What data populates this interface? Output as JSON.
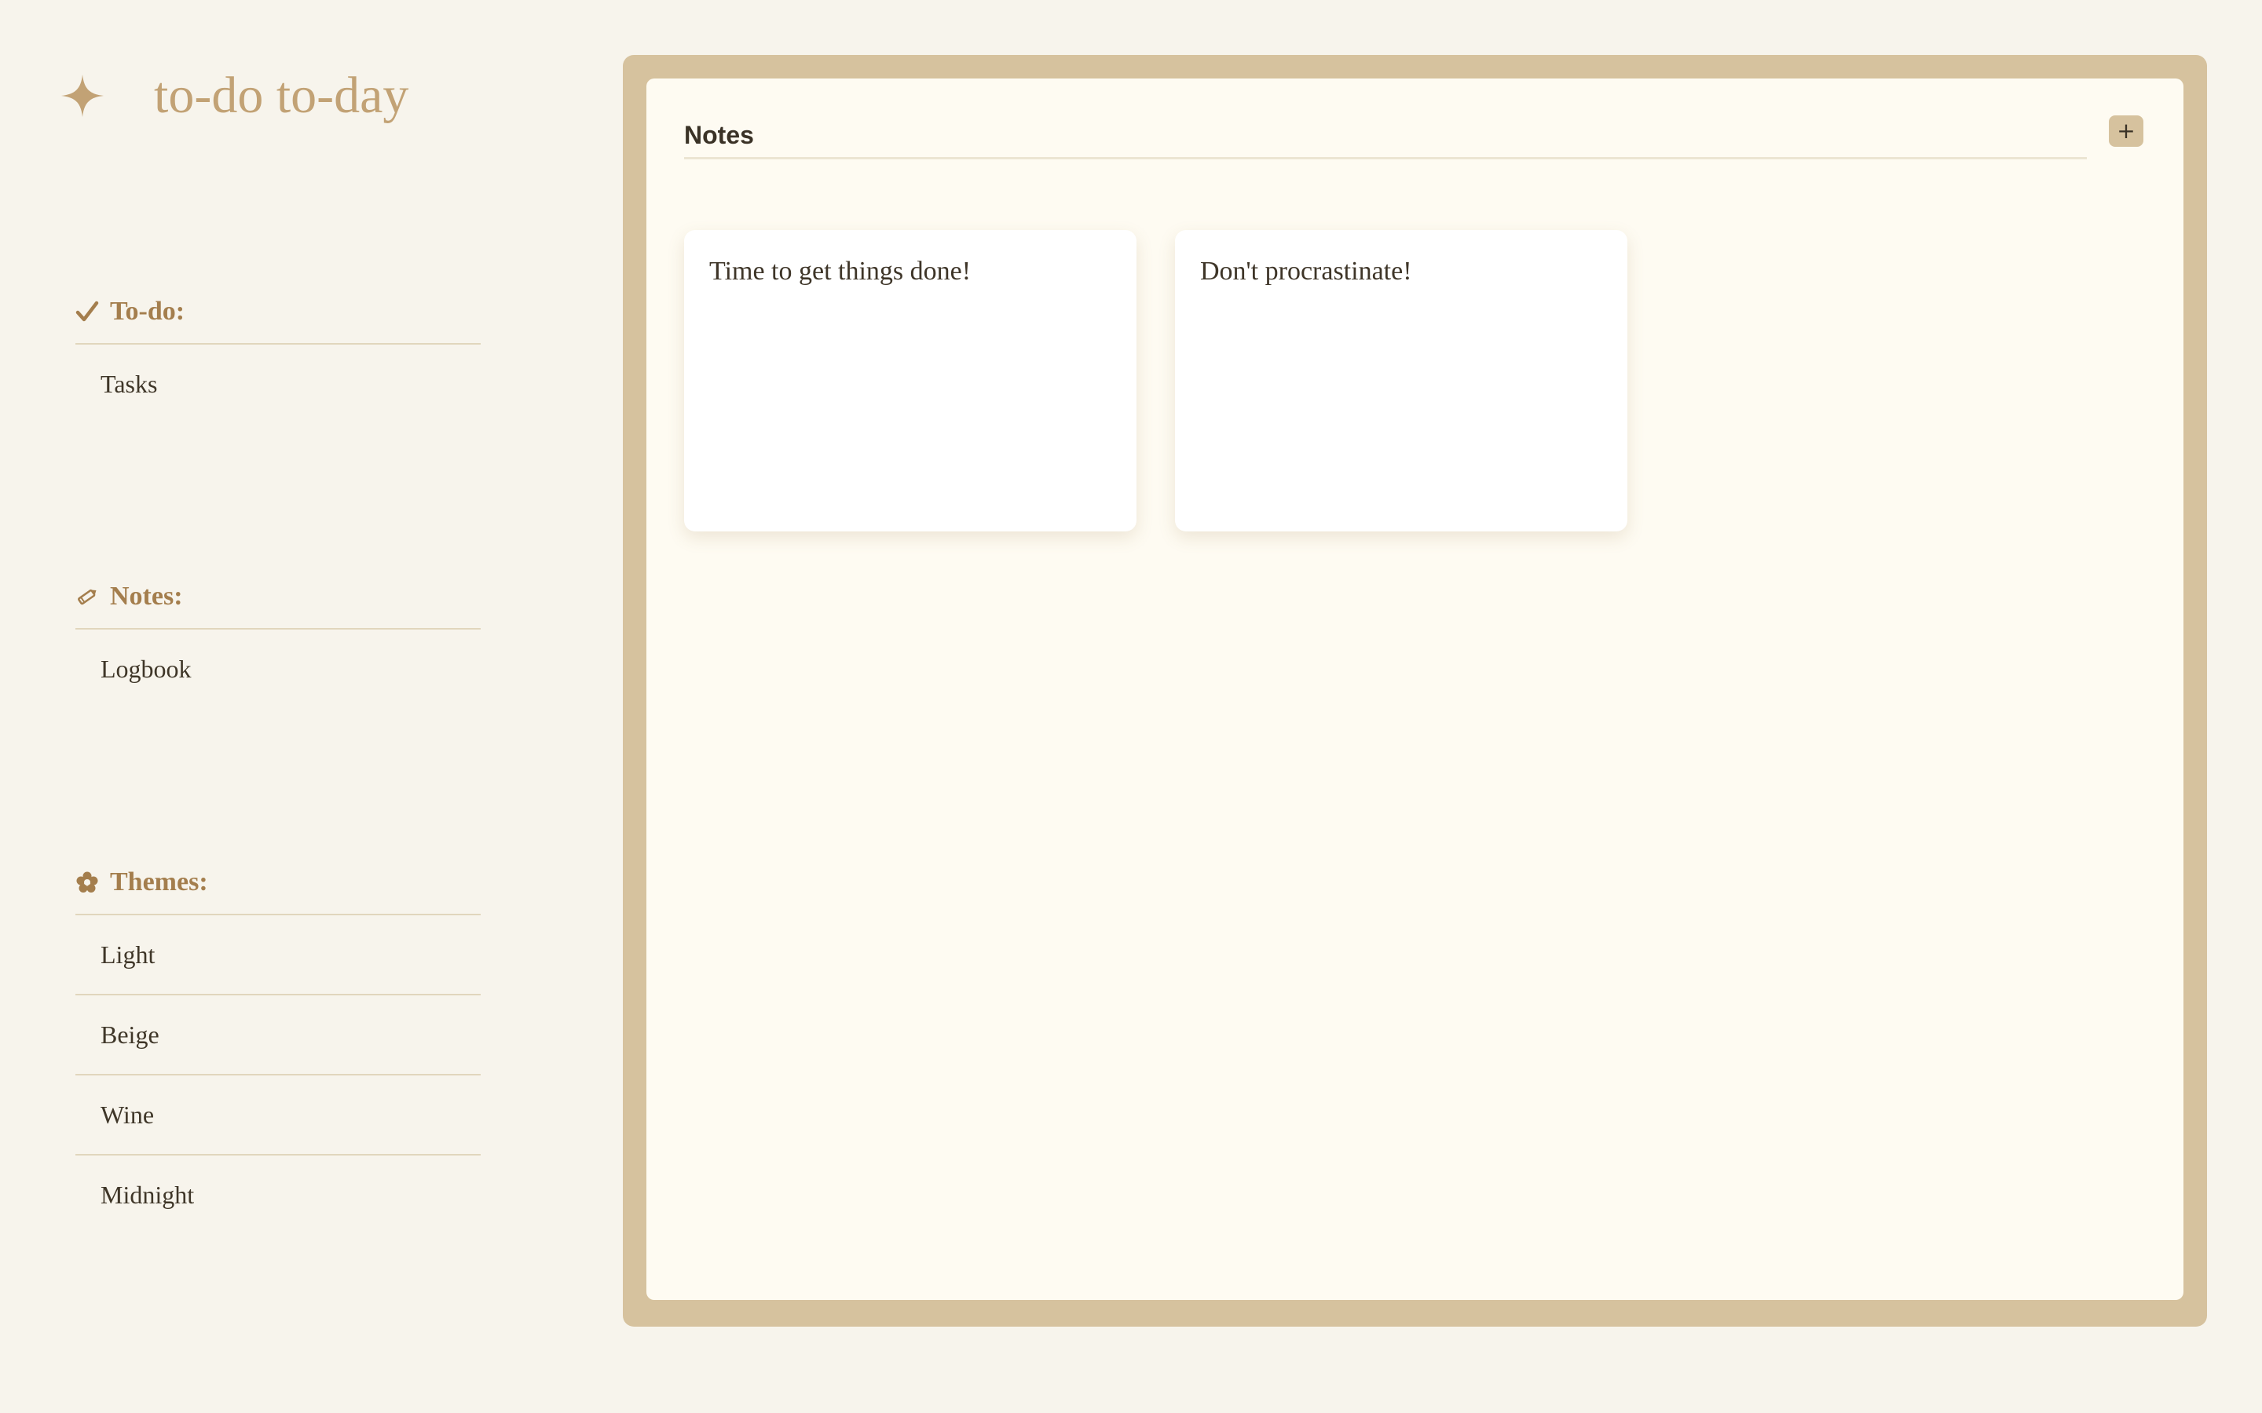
{
  "app": {
    "title": "to-do to-day",
    "brand_icon": "sparkle-icon"
  },
  "colors": {
    "background": "#f7f4ec",
    "accent": "#c2a275",
    "section_header": "#a47e4d",
    "frame": "#d6c29e",
    "panel": "#fefbf2",
    "card": "#ffffff",
    "text": "#3e3528"
  },
  "sidebar": {
    "todo": {
      "icon": "check-icon",
      "label": "To-do:",
      "items": [
        {
          "label": "Tasks"
        }
      ]
    },
    "notes": {
      "icon": "pencil-icon",
      "label": "Notes:",
      "items": [
        {
          "label": "Logbook"
        }
      ]
    },
    "themes": {
      "icon": "flower-icon",
      "label": "Themes:",
      "items": [
        {
          "label": "Light"
        },
        {
          "label": "Beige"
        },
        {
          "label": "Wine"
        },
        {
          "label": "Midnight"
        }
      ]
    }
  },
  "main": {
    "title": "Notes",
    "add_label": "+",
    "notes": [
      {
        "text": "Time to get things done!"
      },
      {
        "text": "Don't procrastinate!"
      }
    ]
  }
}
